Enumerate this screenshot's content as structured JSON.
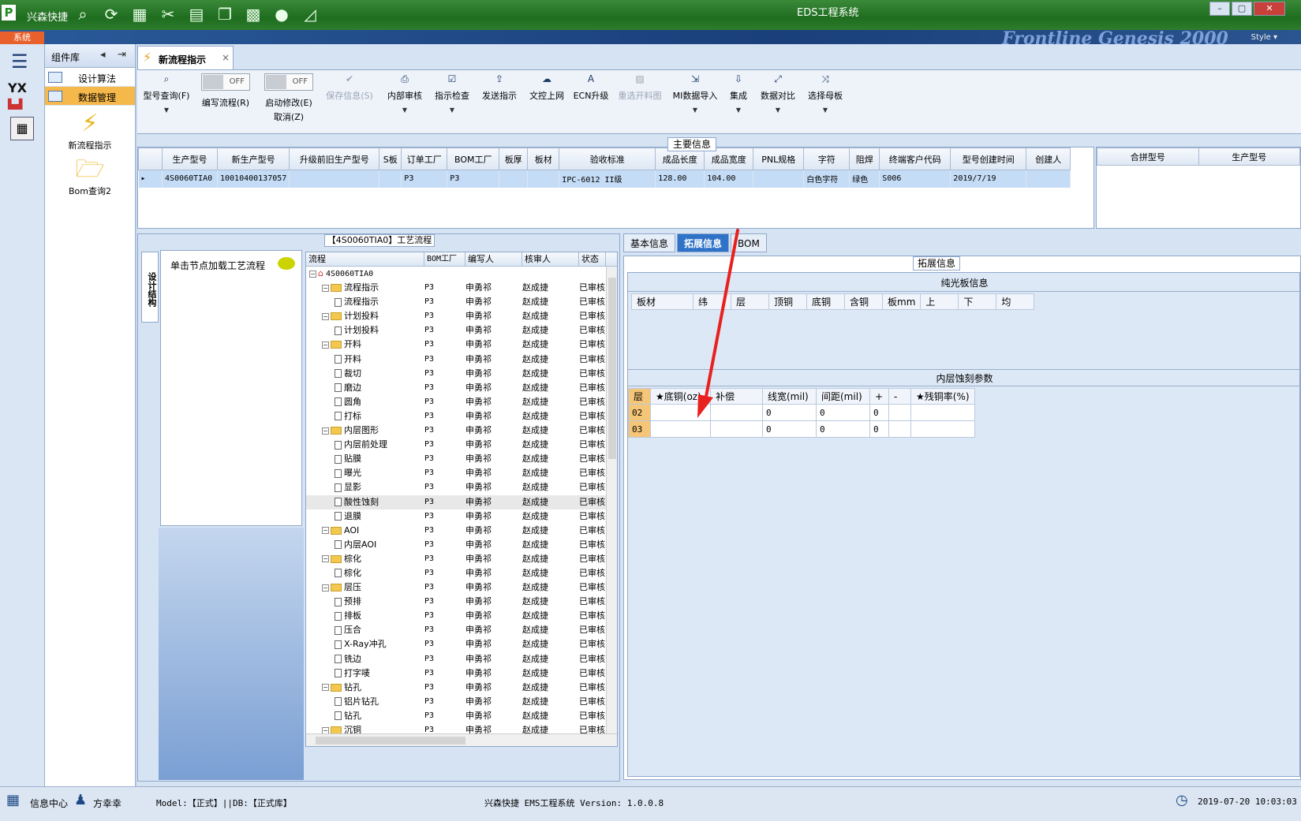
{
  "titlebar": {
    "app_name": "兴森快捷",
    "window_title": "EDS工程系统",
    "icons": [
      "search-icon",
      "refresh-icon",
      "grid-icon",
      "cut-icon",
      "film-icon",
      "copy-icon",
      "table-icon",
      "user-icon",
      "chart-icon"
    ]
  },
  "menustrip": {
    "system_tab": "系统",
    "brand": "Frontline  Genesis 2000",
    "style_label": "Style"
  },
  "component_panel": {
    "title": "组件库",
    "items": [
      {
        "label": "设计算法",
        "selected": false
      },
      {
        "label": "数据管理",
        "selected": true
      }
    ],
    "big_items": [
      {
        "label": "新流程指示",
        "icon": "lightning-icon"
      },
      {
        "label": "Bom查询2",
        "icon": "folder-icon"
      }
    ]
  },
  "doc_tab": {
    "label": "新流程指示",
    "close": "×"
  },
  "ribbon": {
    "buttons": [
      {
        "label": "型号查询(F)",
        "icon": "search-icon",
        "dropdown": true,
        "disabled": false
      },
      {
        "label": "编写流程(R)",
        "toggle": "OFF",
        "disabled": false
      },
      {
        "label": "启动修改(E)",
        "label2": "取消(Z)",
        "toggle": "OFF",
        "disabled": false
      },
      {
        "label": "保存信息(S)",
        "icon": "check-icon",
        "disabled": true
      },
      {
        "label": "内部审核",
        "icon": "print-icon",
        "dropdown": true,
        "disabled": false
      },
      {
        "label": "指示检查",
        "icon": "checkbox-icon",
        "dropdown": true,
        "disabled": false
      },
      {
        "label": "发送指示",
        "icon": "upload-icon",
        "disabled": false
      },
      {
        "label": "文控上网",
        "icon": "cloud-icon",
        "disabled": false
      },
      {
        "label": "ECN升级",
        "icon": "ecn-icon",
        "disabled": false
      },
      {
        "label": "重选开料图",
        "icon": "image-icon",
        "disabled": true
      },
      {
        "label": "MI数据导入",
        "icon": "import-icon",
        "dropdown": true,
        "disabled": false
      },
      {
        "label": "集成",
        "icon": "download-icon",
        "dropdown": true,
        "disabled": false
      },
      {
        "label": "数据对比",
        "icon": "compare-icon",
        "dropdown": true,
        "disabled": false
      },
      {
        "label": "选择母板",
        "icon": "shuffle-icon",
        "dropdown": true,
        "disabled": false
      }
    ]
  },
  "main_info": {
    "title": "主要信息",
    "columns": [
      "生产型号",
      "新生产型号",
      "升级前旧生产型号",
      "S板",
      "订单工厂",
      "BOM工厂",
      "板厚",
      "板材",
      "验收标准",
      "成品长度",
      "成品宽度",
      "PNL规格",
      "字符",
      "阻焊",
      "终端客户代码",
      "型号创建时间",
      "创建人"
    ],
    "rows": [
      [
        "4S0060TIA0",
        "10010400137057",
        "",
        "",
        "P3",
        "P3",
        "",
        "",
        "IPC-6012 II级",
        "128.00",
        "104.00",
        "",
        "白色字符",
        "绿色",
        "S006",
        "2019/7/19",
        ""
      ]
    ],
    "merge_columns": [
      "合拼型号",
      "生产型号"
    ]
  },
  "flow_panel": {
    "title": "【4S0060TIA0】工艺流程",
    "vertical_tab": "设计结构",
    "tip": "单击节点加载工艺流程",
    "columns": [
      "流程",
      "BOM工厂",
      "编写人",
      "核审人",
      "状态"
    ],
    "rows": [
      {
        "name": "4S0060TIA0",
        "level": 0,
        "type": "root",
        "bom": "",
        "writer": "",
        "reviewer": "",
        "status": ""
      },
      {
        "name": "流程指示",
        "level": 1,
        "type": "folder",
        "bom": "P3",
        "writer": "申勇祁",
        "reviewer": "赵成捷",
        "status": "已审核"
      },
      {
        "name": "流程指示",
        "level": 2,
        "type": "file",
        "bom": "P3",
        "writer": "申勇祁",
        "reviewer": "赵成捷",
        "status": "已审核"
      },
      {
        "name": "计划投料",
        "level": 1,
        "type": "folder",
        "bom": "P3",
        "writer": "申勇祁",
        "reviewer": "赵成捷",
        "status": "已审核"
      },
      {
        "name": "计划投料",
        "level": 2,
        "type": "file",
        "bom": "P3",
        "writer": "申勇祁",
        "reviewer": "赵成捷",
        "status": "已审核"
      },
      {
        "name": "开料",
        "level": 1,
        "type": "folder",
        "bom": "P3",
        "writer": "申勇祁",
        "reviewer": "赵成捷",
        "status": "已审核"
      },
      {
        "name": "开料",
        "level": 2,
        "type": "file",
        "bom": "P3",
        "writer": "申勇祁",
        "reviewer": "赵成捷",
        "status": "已审核"
      },
      {
        "name": "裁切",
        "level": 2,
        "type": "file",
        "bom": "P3",
        "writer": "申勇祁",
        "reviewer": "赵成捷",
        "status": "已审核"
      },
      {
        "name": "磨边",
        "level": 2,
        "type": "file",
        "bom": "P3",
        "writer": "申勇祁",
        "reviewer": "赵成捷",
        "status": "已审核"
      },
      {
        "name": "圆角",
        "level": 2,
        "type": "file",
        "bom": "P3",
        "writer": "申勇祁",
        "reviewer": "赵成捷",
        "status": "已审核"
      },
      {
        "name": "打标",
        "level": 2,
        "type": "file",
        "bom": "P3",
        "writer": "申勇祁",
        "reviewer": "赵成捷",
        "status": "已审核"
      },
      {
        "name": "内层图形",
        "level": 1,
        "type": "folder",
        "bom": "P3",
        "writer": "申勇祁",
        "reviewer": "赵成捷",
        "status": "已审核"
      },
      {
        "name": "内层前处理",
        "level": 2,
        "type": "file",
        "bom": "P3",
        "writer": "申勇祁",
        "reviewer": "赵成捷",
        "status": "已审核"
      },
      {
        "name": "贴膜",
        "level": 2,
        "type": "file",
        "bom": "P3",
        "writer": "申勇祁",
        "reviewer": "赵成捷",
        "status": "已审核"
      },
      {
        "name": "曝光",
        "level": 2,
        "type": "file",
        "bom": "P3",
        "writer": "申勇祁",
        "reviewer": "赵成捷",
        "status": "已审核"
      },
      {
        "name": "显影",
        "level": 2,
        "type": "file",
        "bom": "P3",
        "writer": "申勇祁",
        "reviewer": "赵成捷",
        "status": "已审核"
      },
      {
        "name": "酸性蚀刻",
        "level": 2,
        "type": "file",
        "bom": "P3",
        "writer": "申勇祁",
        "reviewer": "赵成捷",
        "status": "已审核",
        "highlight": true
      },
      {
        "name": "退膜",
        "level": 2,
        "type": "file",
        "bom": "P3",
        "writer": "申勇祁",
        "reviewer": "赵成捷",
        "status": "已审核"
      },
      {
        "name": "AOI",
        "level": 1,
        "type": "folder",
        "bom": "P3",
        "writer": "申勇祁",
        "reviewer": "赵成捷",
        "status": "已审核"
      },
      {
        "name": "内层AOI",
        "level": 2,
        "type": "file",
        "bom": "P3",
        "writer": "申勇祁",
        "reviewer": "赵成捷",
        "status": "已审核"
      },
      {
        "name": "棕化",
        "level": 1,
        "type": "folder",
        "bom": "P3",
        "writer": "申勇祁",
        "reviewer": "赵成捷",
        "status": "已审核"
      },
      {
        "name": "棕化",
        "level": 2,
        "type": "file",
        "bom": "P3",
        "writer": "申勇祁",
        "reviewer": "赵成捷",
        "status": "已审核"
      },
      {
        "name": "层压",
        "level": 1,
        "type": "folder",
        "bom": "P3",
        "writer": "申勇祁",
        "reviewer": "赵成捷",
        "status": "已审核"
      },
      {
        "name": "预排",
        "level": 2,
        "type": "file",
        "bom": "P3",
        "writer": "申勇祁",
        "reviewer": "赵成捷",
        "status": "已审核"
      },
      {
        "name": "排板",
        "level": 2,
        "type": "file",
        "bom": "P3",
        "writer": "申勇祁",
        "reviewer": "赵成捷",
        "status": "已审核"
      },
      {
        "name": "压合",
        "level": 2,
        "type": "file",
        "bom": "P3",
        "writer": "申勇祁",
        "reviewer": "赵成捷",
        "status": "已审核"
      },
      {
        "name": "X-Ray冲孔",
        "level": 2,
        "type": "file",
        "bom": "P3",
        "writer": "申勇祁",
        "reviewer": "赵成捷",
        "status": "已审核"
      },
      {
        "name": "铣边",
        "level": 2,
        "type": "file",
        "bom": "P3",
        "writer": "申勇祁",
        "reviewer": "赵成捷",
        "status": "已审核"
      },
      {
        "name": "打字唛",
        "level": 2,
        "type": "file",
        "bom": "P3",
        "writer": "申勇祁",
        "reviewer": "赵成捷",
        "status": "已审核"
      },
      {
        "name": "钻孔",
        "level": 1,
        "type": "folder",
        "bom": "P3",
        "writer": "申勇祁",
        "reviewer": "赵成捷",
        "status": "已审核"
      },
      {
        "name": "铝片钻孔",
        "level": 2,
        "type": "file",
        "bom": "P3",
        "writer": "申勇祁",
        "reviewer": "赵成捷",
        "status": "已审核"
      },
      {
        "name": "钻孔",
        "level": 2,
        "type": "file",
        "bom": "P3",
        "writer": "申勇祁",
        "reviewer": "赵成捷",
        "status": "已审核"
      },
      {
        "name": "沉铜",
        "level": 1,
        "type": "folder",
        "bom": "P3",
        "writer": "申勇祁",
        "reviewer": "赵成捷",
        "status": "已审核"
      }
    ]
  },
  "right_panel": {
    "tabs": [
      {
        "label": "基本信息",
        "active": false
      },
      {
        "label": "拓展信息",
        "active": true
      },
      {
        "label": "BOM",
        "active": false
      }
    ],
    "box_title": "拓展信息",
    "bare_board": {
      "title": "纯光板信息",
      "columns": [
        "板材",
        "纬",
        "层",
        "顶铜",
        "底铜",
        "含铜",
        "板mm",
        "上",
        "下",
        "均"
      ]
    },
    "inner_etch": {
      "title": "内层蚀刻参数",
      "columns": [
        "层",
        "★底铜(oz)",
        "补偿",
        "线宽(mil)",
        "间距(mil)",
        "+",
        "-",
        "★残铜率(%)"
      ],
      "rows": [
        [
          "02",
          "",
          "",
          "0",
          "0",
          "0",
          "",
          ""
        ],
        [
          "03",
          "",
          "",
          "0",
          "0",
          "0",
          "",
          ""
        ]
      ]
    }
  },
  "status": {
    "info_center": "信息中心",
    "user": "方幸幸",
    "model": "Model:【正式】||DB:【正式库】",
    "system": "兴森快捷  EMS工程系统  Version: 1.0.0.8",
    "datetime": "2019-07-20 10:03:03"
  },
  "colors": {
    "title_green": "#1f6d1f",
    "selection_orange": "#f5b84a",
    "active_tab_blue": "#2f73c9",
    "arrow_red": "#e8201e"
  }
}
